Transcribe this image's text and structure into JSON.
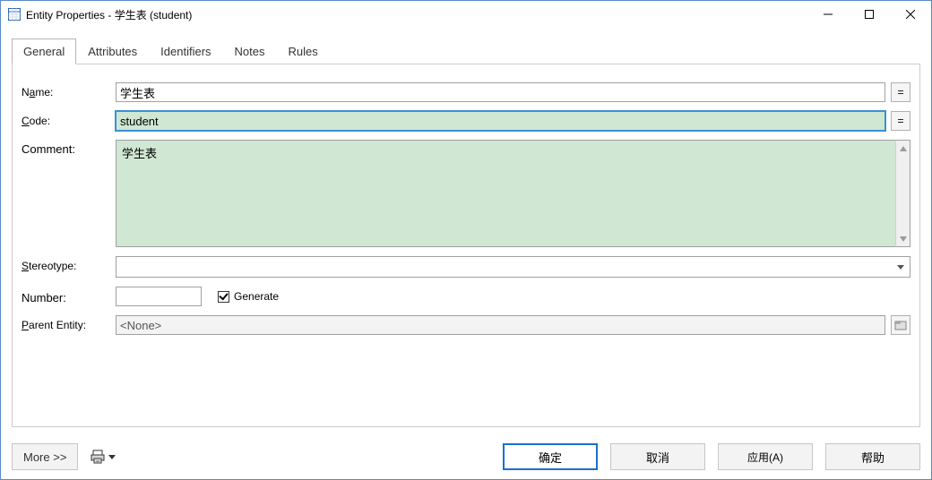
{
  "window": {
    "title": "Entity Properties - 学生表 (student)"
  },
  "tabs": [
    {
      "label": "General"
    },
    {
      "label": "Attributes"
    },
    {
      "label": "Identifiers"
    },
    {
      "label": "Notes"
    },
    {
      "label": "Rules"
    }
  ],
  "labels": {
    "name_pre": "N",
    "name_u": "a",
    "name_post": "me:",
    "code_u": "C",
    "code_post": "ode:",
    "comment": "Comment:",
    "stereo_u": "S",
    "stereo_post": "tereotype:",
    "number": "Number:",
    "gen_u": "G",
    "gen_post": "enerate",
    "parent_u": "P",
    "parent_post": "arent Entity:"
  },
  "fields": {
    "name": "学生表",
    "code": "student",
    "comment": "学生表",
    "stereotype": "",
    "number": "",
    "generate_checked": true,
    "parent_entity": "<None>"
  },
  "footer": {
    "more": "More >>",
    "ok": "确定",
    "cancel": "取消",
    "apply": "应用(A)",
    "help": "帮助"
  }
}
